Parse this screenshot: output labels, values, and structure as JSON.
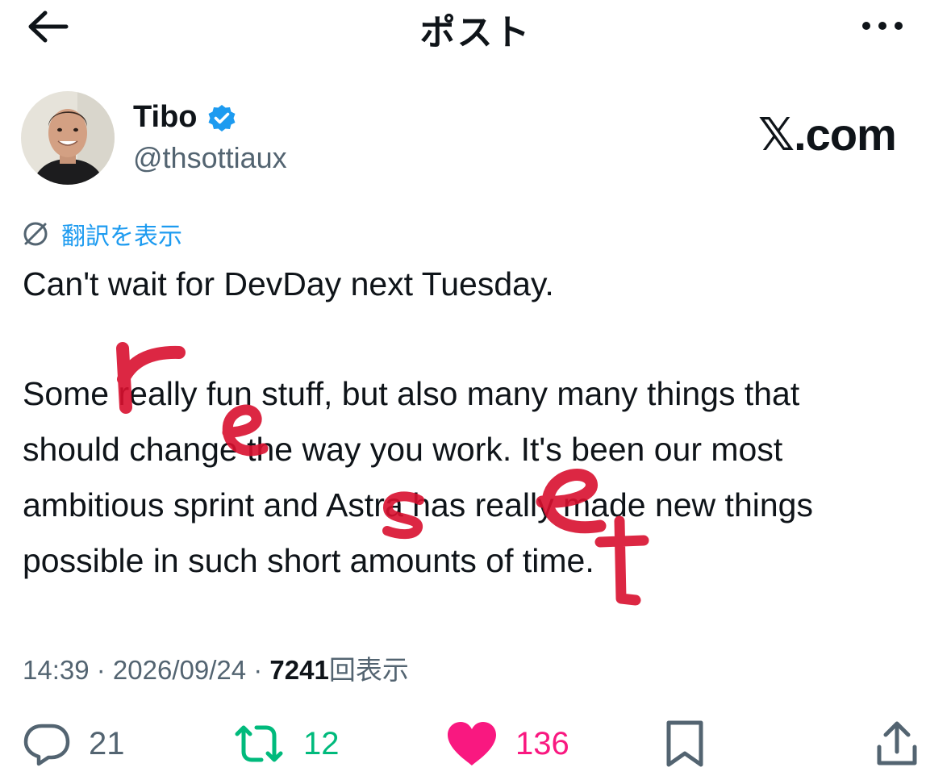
{
  "header": {
    "title": "ポスト"
  },
  "author": {
    "name": "Tibo",
    "handle": "@thsottiaux"
  },
  "watermark": "𝕏.com",
  "translate": {
    "label": "翻訳を表示"
  },
  "tweet": {
    "lines": [
      "Can't wait for DevDay next Tuesday.",
      "Some really fun stuff, but also many many things that",
      "should change the way you work. It's been our most",
      "ambitious sprint and Astra has really made new things",
      "possible in such short amounts of time."
    ]
  },
  "meta": {
    "time": "14:39",
    "date": "2026/09/24",
    "views": "7241",
    "views_suffix": "回表示"
  },
  "actions": {
    "replies": "21",
    "reposts": "12",
    "likes": "136"
  },
  "annotation": {
    "handwritten": [
      "r",
      "e",
      "s",
      "e",
      "t"
    ],
    "color": "#d8102f"
  },
  "colors": {
    "accent": "#1d9bf0",
    "repost": "#00ba7c",
    "like": "#f91880",
    "secondary": "#536471"
  }
}
